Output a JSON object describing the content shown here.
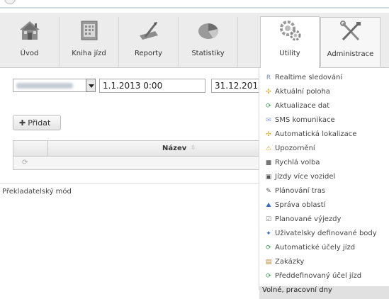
{
  "nav": {
    "items": [
      {
        "label": "Úvod",
        "icon": "home-icon"
      },
      {
        "label": "Kniha jízd",
        "icon": "book-icon"
      },
      {
        "label": "Reporty",
        "icon": "report-icon"
      },
      {
        "label": "Statistiky",
        "icon": "chart-icon"
      },
      {
        "label": "Utility",
        "icon": "gears-icon"
      },
      {
        "label": "Administrace",
        "icon": "tools-icon"
      }
    ]
  },
  "filters": {
    "date_from": "1.1.2013 0:00",
    "date_to": "31.12.201"
  },
  "toolbar": {
    "add_label": "Přidat"
  },
  "grid": {
    "name_header": "Název",
    "sort_icon": "sort-icon"
  },
  "footer": {
    "translator_mode": "Překladatelský mód"
  },
  "utility_menu": {
    "items": [
      {
        "label": "Realtime sledování",
        "icon": "R",
        "color": "#7a8fb8"
      },
      {
        "label": "Aktuální poloha",
        "icon": "✣",
        "color": "#e0a020"
      },
      {
        "label": "Aktualizace dat",
        "icon": "⟳",
        "color": "#3aa24a"
      },
      {
        "label": "SMS komunikace",
        "icon": "✉",
        "color": "#8aa0c8"
      },
      {
        "label": "Automatická lokalizace",
        "icon": "✣",
        "color": "#e0a020"
      },
      {
        "label": "Upozornění",
        "icon": "⚠",
        "color": "#e0a020"
      },
      {
        "label": "Rychlá volba",
        "icon": "■",
        "color": "#777777"
      },
      {
        "label": "Jízdy více vozidel",
        "icon": "▣",
        "color": "#555555"
      },
      {
        "label": "Plánování tras",
        "icon": "✎",
        "color": "#555555"
      },
      {
        "label": "Správa oblastí",
        "icon": "⛰",
        "color": "#3a6fb8"
      },
      {
        "label": "Planované výjezdy",
        "icon": "☑",
        "color": "#777777"
      },
      {
        "label": "Uživatelsky definované body",
        "icon": "✦",
        "color": "#3a6fb8"
      },
      {
        "label": "Automatické účely jízd",
        "icon": "⟳",
        "color": "#3aa24a"
      },
      {
        "label": "Zakázky",
        "icon": "▤",
        "color": "#b8862a"
      },
      {
        "label": "Předdefinovaný účel jízd",
        "icon": "⟳",
        "color": "#3aa24a"
      },
      {
        "label": "Volné, pracovní dny",
        "icon": "",
        "color": "#333333"
      }
    ]
  }
}
